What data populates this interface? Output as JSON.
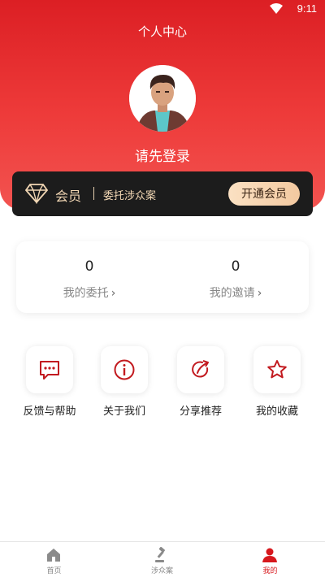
{
  "status_bar": {
    "time": "9:11"
  },
  "header": {
    "title": "个人中心"
  },
  "profile": {
    "login_prompt": "请先登录"
  },
  "vip": {
    "label": "会员",
    "description": "委托涉众案",
    "button": "开通会员"
  },
  "stats": [
    {
      "value": "0",
      "label": "我的委托"
    },
    {
      "value": "0",
      "label": "我的邀请"
    }
  ],
  "quick_actions": [
    {
      "label": "反馈与帮助",
      "icon": "message-dots-icon"
    },
    {
      "label": "关于我们",
      "icon": "info-icon"
    },
    {
      "label": "分享推荐",
      "icon": "share-icon"
    },
    {
      "label": "我的收藏",
      "icon": "star-icon"
    }
  ],
  "tabs": [
    {
      "label": "首页",
      "icon": "home-icon"
    },
    {
      "label": "涉众案",
      "icon": "gavel-icon"
    },
    {
      "label": "我的",
      "icon": "user-icon",
      "active": true
    }
  ],
  "colors": {
    "accent": "#d7181d",
    "vip_bg": "#1c1c1c",
    "vip_gold": "#f2d7b4"
  }
}
